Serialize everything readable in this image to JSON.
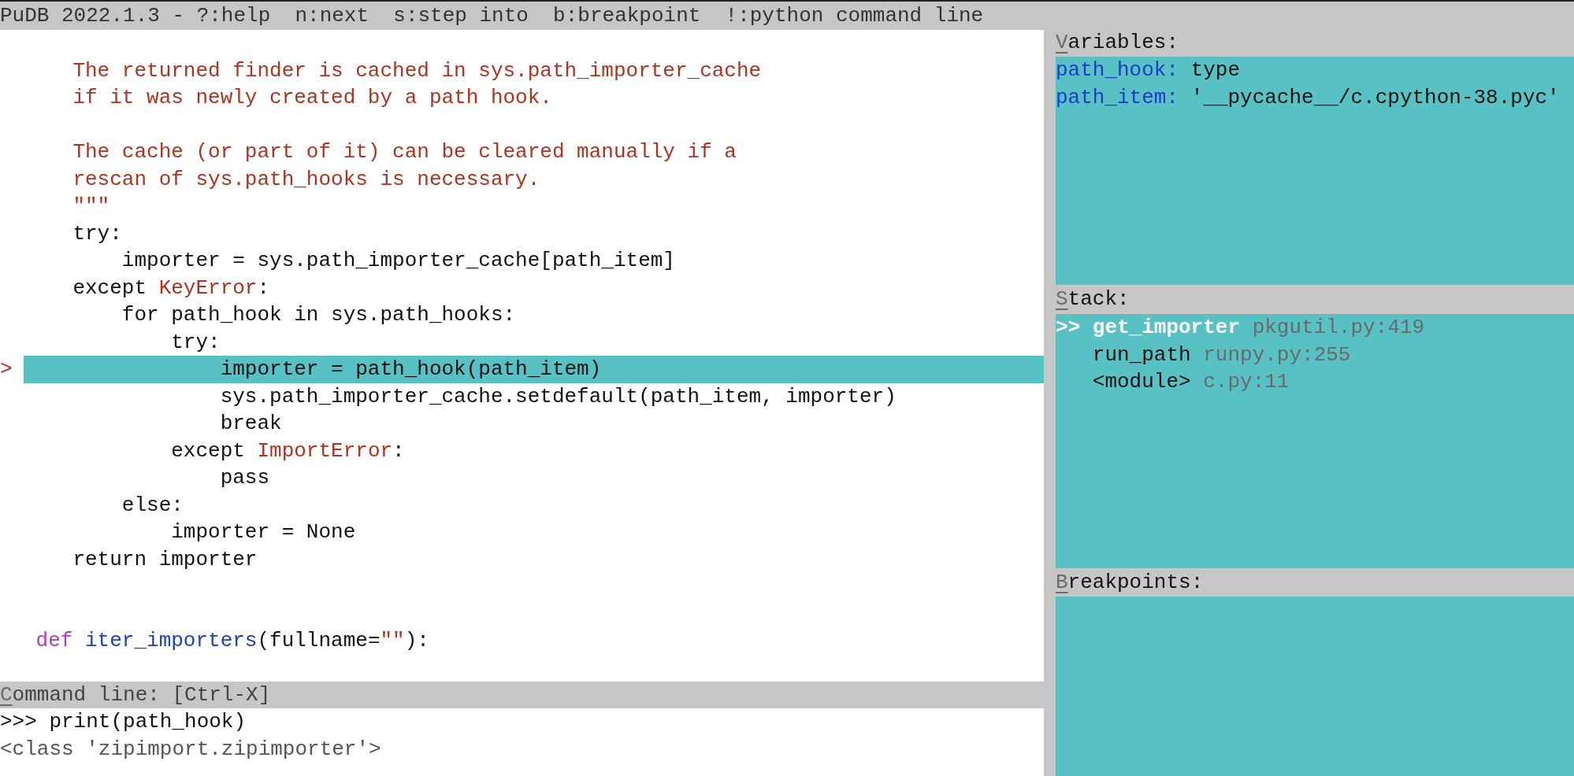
{
  "title_bar": {
    "text": "PuDB 2022.1.3 - ?:help  n:next  s:step into  b:breakpoint  !:python command line"
  },
  "source": {
    "lines": [
      {
        "current": false
      },
      {
        "current": false,
        "tokens": [
          {
            "kind": "string",
            "text": "    The returned finder is cached in sys.path_importer_cache"
          }
        ]
      },
      {
        "current": false,
        "tokens": [
          {
            "kind": "string",
            "text": "    if it was newly created by a path hook."
          }
        ]
      },
      {
        "current": false
      },
      {
        "current": false,
        "tokens": [
          {
            "kind": "string",
            "text": "    The cache (or part of it) can be cleared manually if a"
          }
        ]
      },
      {
        "current": false,
        "tokens": [
          {
            "kind": "string",
            "text": "    rescan of sys.path_hooks is necessary."
          }
        ]
      },
      {
        "current": false,
        "tokens": [
          {
            "kind": "string",
            "text": "    \"\"\""
          }
        ]
      },
      {
        "current": false,
        "tokens": [
          {
            "kind": "plain",
            "text": "    try:"
          }
        ]
      },
      {
        "current": false,
        "tokens": [
          {
            "kind": "plain",
            "text": "        importer = sys.path_importer_cache[path_item]"
          }
        ]
      },
      {
        "current": false,
        "tokens": [
          {
            "kind": "plain",
            "text": "    except "
          },
          {
            "kind": "exception",
            "text": "KeyError"
          },
          {
            "kind": "plain",
            "text": ":"
          }
        ]
      },
      {
        "current": false,
        "tokens": [
          {
            "kind": "plain",
            "text": "        for path_hook in sys.path_hooks:"
          }
        ]
      },
      {
        "current": false,
        "tokens": [
          {
            "kind": "plain",
            "text": "            try:"
          }
        ]
      },
      {
        "current": true,
        "marker": ">",
        "tokens": [
          {
            "kind": "plain",
            "text": "                importer = path_hook(path_item)"
          }
        ]
      },
      {
        "current": false,
        "tokens": [
          {
            "kind": "plain",
            "text": "                sys.path_importer_cache.setdefault(path_item, importer)"
          }
        ]
      },
      {
        "current": false,
        "tokens": [
          {
            "kind": "plain",
            "text": "                break"
          }
        ]
      },
      {
        "current": false,
        "tokens": [
          {
            "kind": "plain",
            "text": "            except "
          },
          {
            "kind": "exception",
            "text": "ImportError"
          },
          {
            "kind": "plain",
            "text": ":"
          }
        ]
      },
      {
        "current": false,
        "tokens": [
          {
            "kind": "plain",
            "text": "                pass"
          }
        ]
      },
      {
        "current": false,
        "tokens": [
          {
            "kind": "plain",
            "text": "        else:"
          }
        ]
      },
      {
        "current": false,
        "tokens": [
          {
            "kind": "plain",
            "text": "            importer = None"
          }
        ]
      },
      {
        "current": false,
        "tokens": [
          {
            "kind": "plain",
            "text": "    return importer"
          }
        ]
      },
      {
        "current": false
      },
      {
        "current": false
      },
      {
        "current": false,
        "tokens": [
          {
            "kind": "keyword",
            "text": " def "
          },
          {
            "kind": "function",
            "text": "iter_importers"
          },
          {
            "kind": "plain",
            "text": "(fullname="
          },
          {
            "kind": "string",
            "text": "\"\""
          },
          {
            "kind": "plain",
            "text": "):"
          }
        ]
      },
      {
        "current": false
      }
    ]
  },
  "command_line": {
    "header": "Command line: [Ctrl-X]",
    "lines": [
      {
        "kind": "input",
        "text": ">>> print(path_hook)"
      },
      {
        "kind": "output",
        "text": "<class 'zipimport.zipimporter'>"
      }
    ]
  },
  "variables": {
    "header": "Variables:",
    "items": [
      {
        "name": "path_hook:",
        "value": "type"
      },
      {
        "name": "path_item:",
        "value": "'__pycache__/c.cpython-38.pyc'"
      }
    ]
  },
  "stack": {
    "header": "Stack:",
    "frames": [
      {
        "selected": true,
        "marker": ">>",
        "function": "get_importer",
        "location": "pkgutil.py:419"
      },
      {
        "selected": false,
        "function": "run_path",
        "location": "runpy.py:255"
      },
      {
        "selected": false,
        "function": "<module>",
        "location": "c.py:11"
      }
    ]
  },
  "breakpoints": {
    "header": "Breakpoints:"
  }
}
